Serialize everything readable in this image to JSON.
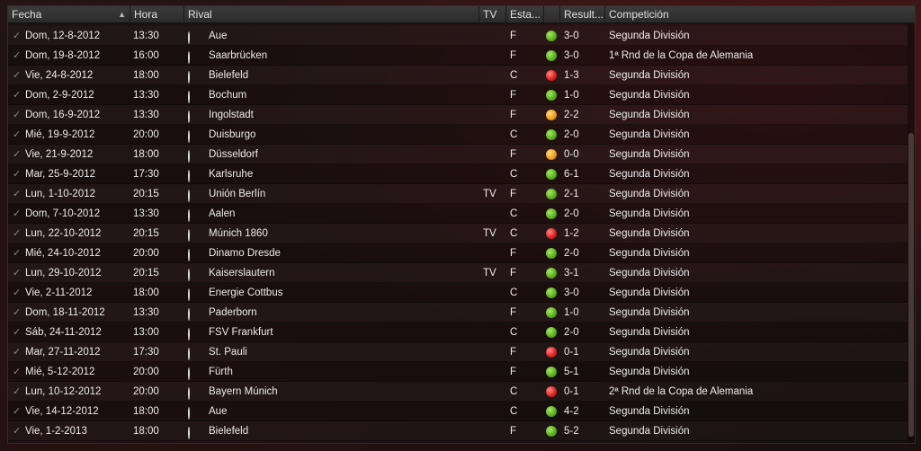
{
  "header": {
    "columns": {
      "date": "Fecha",
      "time": "Hora",
      "rival": "Rival",
      "tv": "TV",
      "venue": "Esta...",
      "result": "Result...",
      "competition": "Competición"
    }
  },
  "colors": {
    "win": "#5fb024",
    "loss": "#e02525",
    "draw": "#f0a020"
  },
  "rows": [
    {
      "date": "Dom, 12-8-2012",
      "time": "13:30",
      "rival": "Aue",
      "tv": "",
      "venue": "F",
      "outcome": "win",
      "score": "3-0",
      "competition": "Segunda División",
      "crest_color": "#6b7fc0"
    },
    {
      "date": "Dom, 19-8-2012",
      "time": "16:00",
      "rival": "Saarbrücken",
      "tv": "",
      "venue": "F",
      "outcome": "win",
      "score": "3-0",
      "competition": "1ª Rnd de la Copa de Alemania",
      "crest_color": "#2a2a2a"
    },
    {
      "date": "Vie, 24-8-2012",
      "time": "18:00",
      "rival": "Bielefeld",
      "tv": "",
      "venue": "C",
      "outcome": "loss",
      "score": "1-3",
      "competition": "Segunda División",
      "crest_color": "#1d55b8"
    },
    {
      "date": "Dom, 2-9-2012",
      "time": "13:30",
      "rival": "Bochum",
      "tv": "",
      "venue": "F",
      "outcome": "win",
      "score": "1-0",
      "competition": "Segunda División",
      "crest_color": "#1b4aa0"
    },
    {
      "date": "Dom, 16-9-2012",
      "time": "13:30",
      "rival": "Ingolstadt",
      "tv": "",
      "venue": "F",
      "outcome": "draw",
      "score": "2-2",
      "competition": "Segunda División",
      "crest_color": "#c8202a"
    },
    {
      "date": "Mié, 19-9-2012",
      "time": "20:00",
      "rival": "Duisburgo",
      "tv": "",
      "venue": "C",
      "outcome": "win",
      "score": "2-0",
      "competition": "Segunda División",
      "crest_color": "#6fb6e8"
    },
    {
      "date": "Vie, 21-9-2012",
      "time": "18:00",
      "rival": "Düsseldorf",
      "tv": "",
      "venue": "F",
      "outcome": "draw",
      "score": "0-0",
      "competition": "Segunda División",
      "crest_color": "#d01a20"
    },
    {
      "date": "Mar, 25-9-2012",
      "time": "17:30",
      "rival": "Karlsruhe",
      "tv": "",
      "venue": "C",
      "outcome": "win",
      "score": "6-1",
      "competition": "Segunda División",
      "crest_color": "#1a3ca8"
    },
    {
      "date": "Lun, 1-10-2012",
      "time": "20:15",
      "rival": "Unión Berlín",
      "tv": "TV",
      "venue": "F",
      "outcome": "win",
      "score": "2-1",
      "competition": "Segunda División",
      "crest_color": "#d41820"
    },
    {
      "date": "Dom, 7-10-2012",
      "time": "13:30",
      "rival": "Aalen",
      "tv": "",
      "venue": "C",
      "outcome": "win",
      "score": "2-0",
      "competition": "Segunda División",
      "crest_color": "#2a2a2a"
    },
    {
      "date": "Lun, 22-10-2012",
      "time": "20:15",
      "rival": "Múnich 1860",
      "tv": "TV",
      "venue": "C",
      "outcome": "loss",
      "score": "1-2",
      "competition": "Segunda División",
      "crest_color": "#3a6cc8"
    },
    {
      "date": "Mié, 24-10-2012",
      "time": "20:00",
      "rival": "Dinamo Dresde",
      "tv": "",
      "venue": "F",
      "outcome": "win",
      "score": "2-0",
      "competition": "Segunda División",
      "crest_color": "#d82020"
    },
    {
      "date": "Lun, 29-10-2012",
      "time": "20:15",
      "rival": "Kaiserslautern",
      "tv": "TV",
      "venue": "F",
      "outcome": "win",
      "score": "3-1",
      "competition": "Segunda División",
      "crest_color": "#c01a20"
    },
    {
      "date": "Vie, 2-11-2012",
      "time": "18:00",
      "rival": "Energie Cottbus",
      "tv": "",
      "venue": "C",
      "outcome": "win",
      "score": "3-0",
      "competition": "Segunda División",
      "crest_color": "#e02020"
    },
    {
      "date": "Dom, 18-11-2012",
      "time": "13:30",
      "rival": "Paderborn",
      "tv": "",
      "venue": "F",
      "outcome": "win",
      "score": "1-0",
      "competition": "Segunda División",
      "crest_color": "#2a5ab8"
    },
    {
      "date": "Sáb, 24-11-2012",
      "time": "13:00",
      "rival": "FSV Frankfurt",
      "tv": "",
      "venue": "C",
      "outcome": "win",
      "score": "2-0",
      "competition": "Segunda División",
      "crest_color": "#c81a28"
    },
    {
      "date": "Mar, 27-11-2012",
      "time": "17:30",
      "rival": "St. Pauli",
      "tv": "",
      "venue": "F",
      "outcome": "loss",
      "score": "0-1",
      "competition": "Segunda División",
      "crest_color": "#8a5a3a"
    },
    {
      "date": "Mié, 5-12-2012",
      "time": "20:00",
      "rival": "Fürth",
      "tv": "",
      "venue": "F",
      "outcome": "win",
      "score": "5-1",
      "competition": "Segunda División",
      "crest_color": "#1a8a3a"
    },
    {
      "date": "Lun, 10-12-2012",
      "time": "20:00",
      "rival": "Bayern Múnich",
      "tv": "",
      "venue": "C",
      "outcome": "loss",
      "score": "0-1",
      "competition": "2ª Rnd de la Copa de Alemania",
      "crest_color": "#d01a2a"
    },
    {
      "date": "Vie, 14-12-2012",
      "time": "18:00",
      "rival": "Aue",
      "tv": "",
      "venue": "C",
      "outcome": "win",
      "score": "4-2",
      "competition": "Segunda División",
      "crest_color": "#6b7fc0"
    },
    {
      "date": "Vie, 1-2-2013",
      "time": "18:00",
      "rival": "Bielefeld",
      "tv": "",
      "venue": "F",
      "outcome": "win",
      "score": "5-2",
      "competition": "Segunda División",
      "crest_color": "#1d55b8"
    }
  ]
}
